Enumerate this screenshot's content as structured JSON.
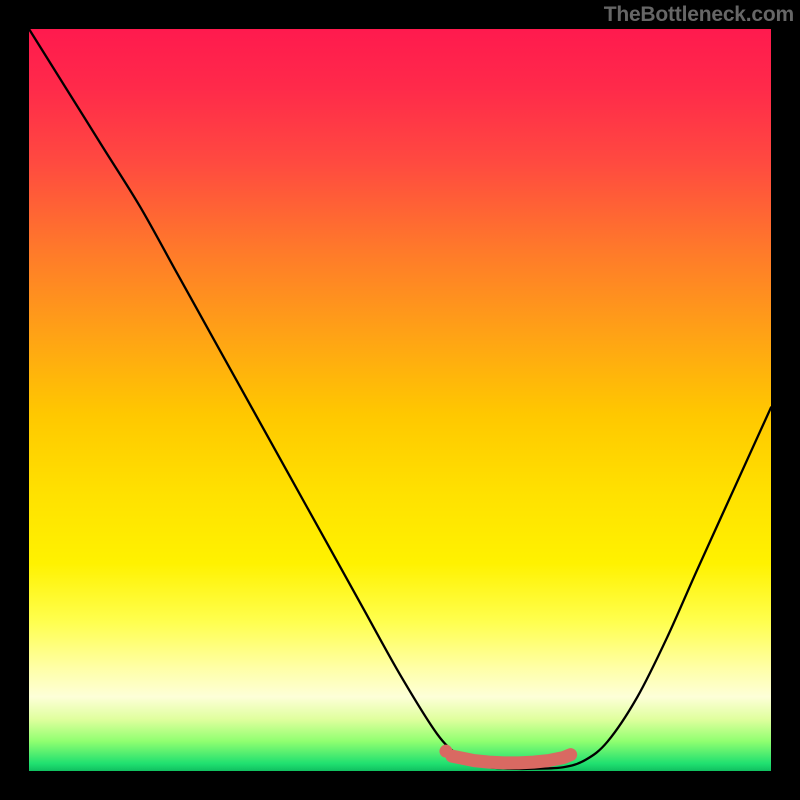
{
  "watermark": "TheBottleneck.com",
  "colors": {
    "background": "#000000",
    "gradient_top": "#ff1a4e",
    "gradient_bottom": "#10c060",
    "curve": "#000000",
    "marker": "#d96962"
  },
  "chart_data": {
    "type": "line",
    "title": "",
    "xlabel": "",
    "ylabel": "",
    "xlim": [
      0,
      100
    ],
    "ylim": [
      0,
      100
    ],
    "x": [
      0,
      5,
      10,
      15,
      20,
      25,
      30,
      35,
      40,
      45,
      50,
      55,
      58,
      60,
      62,
      65,
      68,
      72,
      75,
      78,
      82,
      86,
      90,
      95,
      100
    ],
    "values": [
      100,
      92,
      84,
      76,
      67,
      58,
      49,
      40,
      31,
      22,
      13,
      5,
      2,
      1,
      0.5,
      0.3,
      0.3,
      0.5,
      1.5,
      4,
      10,
      18,
      27,
      38,
      49
    ],
    "markers": {
      "x": [
        57,
        60,
        62,
        64,
        66,
        68,
        70,
        72,
        73
      ],
      "y": [
        2.0,
        1.4,
        1.2,
        1.1,
        1.1,
        1.2,
        1.4,
        1.8,
        2.2
      ]
    }
  }
}
